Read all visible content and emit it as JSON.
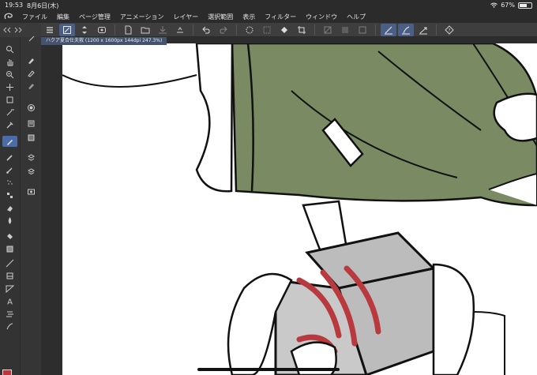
{
  "status_bar": {
    "time": "19:53",
    "date": "8月6日(木)",
    "battery": "67%",
    "battery_level": 0.67
  },
  "menu": {
    "items": [
      "ファイル",
      "編集",
      "ページ管理",
      "アニメーション",
      "レイヤー",
      "選択範囲",
      "表示",
      "フィルター",
      "ウィンドウ",
      "ヘルプ"
    ]
  },
  "document": {
    "tab_label": "ハクア夏合仕夫救 (1200 x 1600px 144dpi 247.3%)"
  },
  "colors": {
    "main_color": "#c0353b",
    "sub_color": "#f0d28a",
    "skirt_green": "#7a8b63",
    "box_gray": "#bcbcbc",
    "stripe_red": "#b83a3e",
    "active_tool": "#4b6ca8"
  },
  "tools": [
    "magnify-icon",
    "hand-icon",
    "zoom-icon",
    "move-icon",
    "selection-icon",
    "wand-icon",
    "eyedropper-icon",
    "pen-icon",
    "pencil-icon",
    "brush-icon",
    "airbrush-icon",
    "decoration-icon",
    "eraser-icon",
    "blend-icon",
    "fill-icon",
    "gradient-icon",
    "figure-icon",
    "frame-icon",
    "ruler-icon",
    "text-icon",
    "balloon-icon",
    "correct-line-icon"
  ],
  "sub_tools": [
    "pen-sub-1-icon",
    "pen-sub-2-icon",
    "pen-sub-3-icon",
    "pen-sub-4-icon",
    "layer-icon",
    "layer-property-icon",
    "navigator-icon",
    "material-icon",
    "camera-icon"
  ],
  "toolbar": {
    "buttons": [
      "menu-icon",
      "pen-tool-icon",
      "swap-icon",
      "new-icon",
      "open-icon",
      "save-icon",
      "export-icon",
      "undo-icon",
      "redo-icon",
      "select-all-icon",
      "deselect-icon",
      "fill-icon",
      "crop-icon",
      "clip-icon",
      "hide-icon",
      "tone-icon",
      "ruler-snap-icon",
      "special-ruler-icon",
      "perspective-icon",
      "help-icon"
    ]
  }
}
